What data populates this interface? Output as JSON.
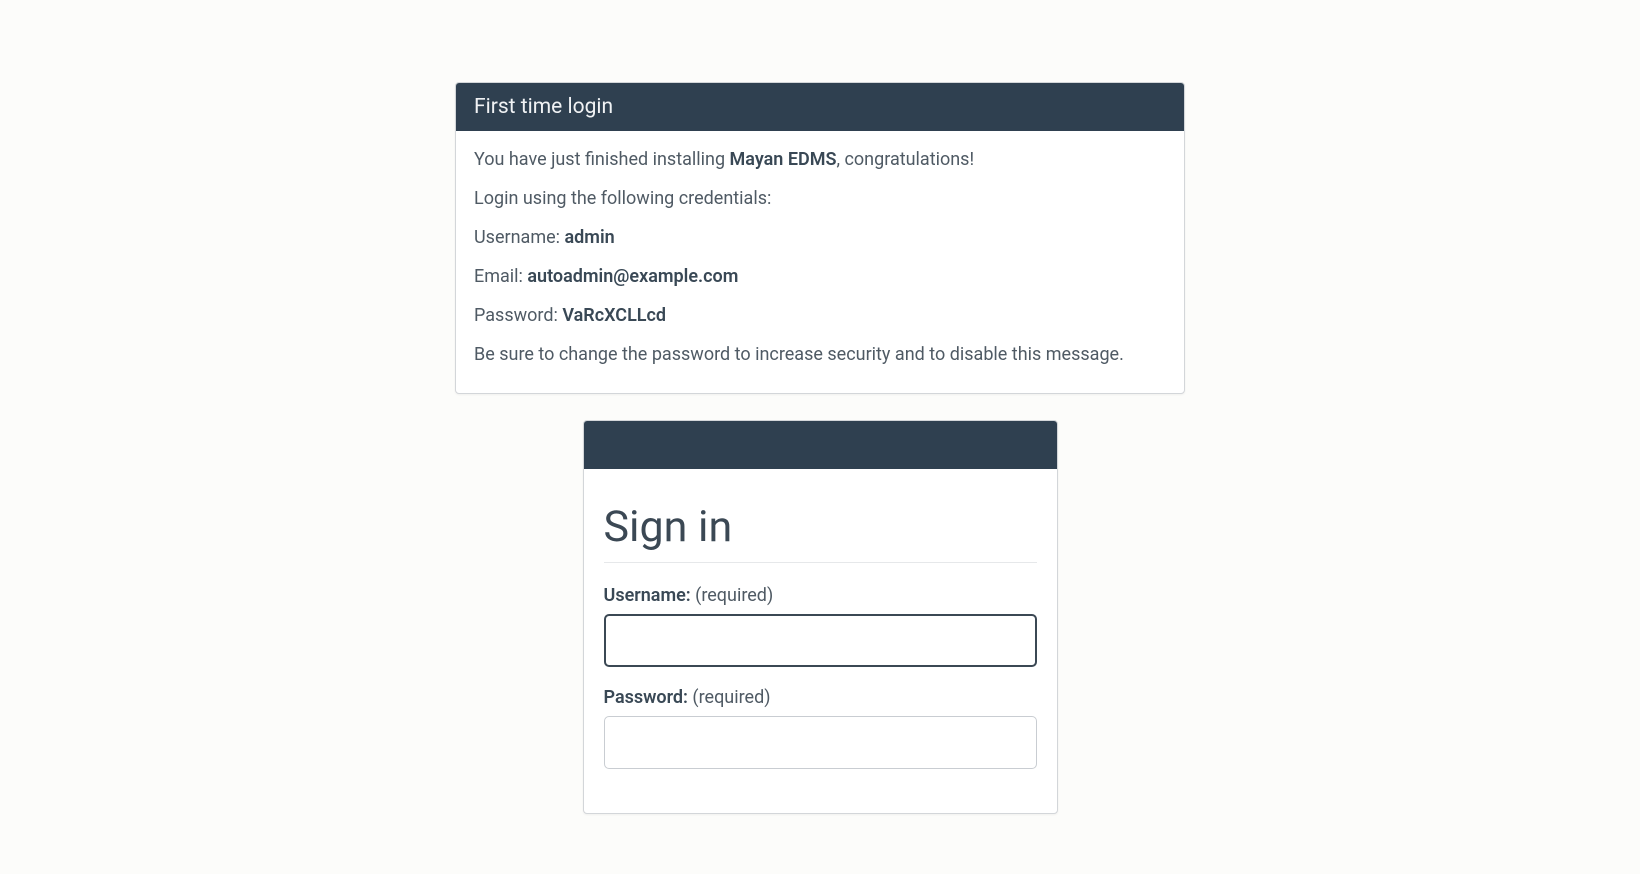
{
  "info_panel": {
    "header": "First time login",
    "line1_prefix": "You have just finished installing ",
    "line1_bold": "Mayan EDMS",
    "line1_suffix": ", congratulations!",
    "line2": "Login using the following credentials:",
    "username_label": "Username: ",
    "username_value": "admin",
    "email_label": "Email: ",
    "email_value": "autoadmin@example.com",
    "password_label": "Password: ",
    "password_value": "VaRcXCLLcd",
    "line_footer": "Be sure to change the password to increase security and to disable this message."
  },
  "signin": {
    "title": "Sign in",
    "username_label_bold": "Username:",
    "username_label_req": " (required)",
    "username_value": "",
    "password_label_bold": "Password:",
    "password_label_req": " (required)",
    "password_value": ""
  }
}
